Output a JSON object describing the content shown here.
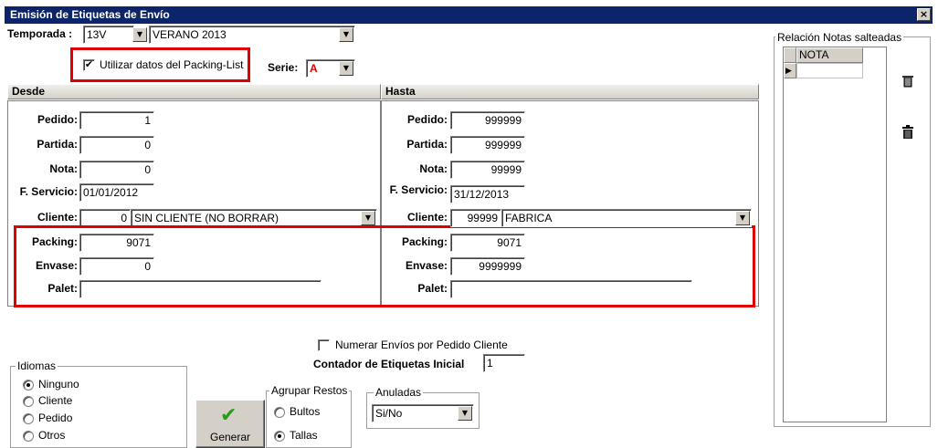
{
  "window": {
    "title": "Emisión de Etiquetas de Envío",
    "close_glyph": "×"
  },
  "top": {
    "temporada_label": "Temporada :",
    "temporada_code": "13V",
    "temporada_name": "VERANO 2013",
    "packing_list_checkbox": {
      "label": "Utilizar datos del Packing-List",
      "checked": true
    },
    "serie_label": "Serie:",
    "serie_value": "A",
    "serie_color": "#e00000"
  },
  "desde": {
    "header": "Desde",
    "pedido_label": "Pedido:",
    "pedido": "1",
    "partida_label": "Partida:",
    "partida": "0",
    "nota_label": "Nota:",
    "nota": "0",
    "servicio_label": "F. Servicio:",
    "servicio": "01/01/2012",
    "cliente_label": "Cliente:",
    "cliente_code": "0",
    "cliente_name": "SIN CLIENTE (NO BORRAR)",
    "packing_label": "Packing:",
    "packing": "9071",
    "envase_label": "Envase:",
    "envase": "0",
    "palet_label": "Palet:",
    "palet": ""
  },
  "hasta": {
    "header": "Hasta",
    "pedido_label": "Pedido:",
    "pedido": "999999",
    "partida_label": "Partida:",
    "partida": "999999",
    "nota_label": "Nota:",
    "nota": "99999",
    "servicio_label": "F. Servicio:",
    "servicio": "31/12/2013",
    "cliente_label": "Cliente:",
    "cliente_code": "99999",
    "cliente_name": "FABRICA",
    "packing_label": "Packing:",
    "packing": "9071",
    "envase_label": "Envase:",
    "envase": "9999999",
    "palet_label": "Palet:",
    "palet": ""
  },
  "bottom": {
    "numerar_checkbox": {
      "label": "Numerar Envíos por Pedido Cliente",
      "checked": false
    },
    "contador_label": "Contador de Etiquetas Inicial",
    "contador_value": "1",
    "idiomas": {
      "title": "Idiomas",
      "options": [
        "Ninguno",
        "Cliente",
        "Pedido",
        "Otros"
      ],
      "selected": "Ninguno"
    },
    "generar_button": {
      "label": "Generar",
      "icon": "checkmark-icon",
      "icon_color": "#2a9a1a"
    },
    "agrupar": {
      "title": "Agrupar Restos",
      "options": [
        "Bultos",
        "Tallas"
      ],
      "selected": "Tallas"
    },
    "anuladas": {
      "title": "Anuladas",
      "value": "Si/No"
    }
  },
  "notas": {
    "title": "Relación Notas salteadas",
    "column": "NOTA",
    "row_indicator": "▶",
    "delete_icon": "trash-icon"
  },
  "highlight_color": "#e00000"
}
